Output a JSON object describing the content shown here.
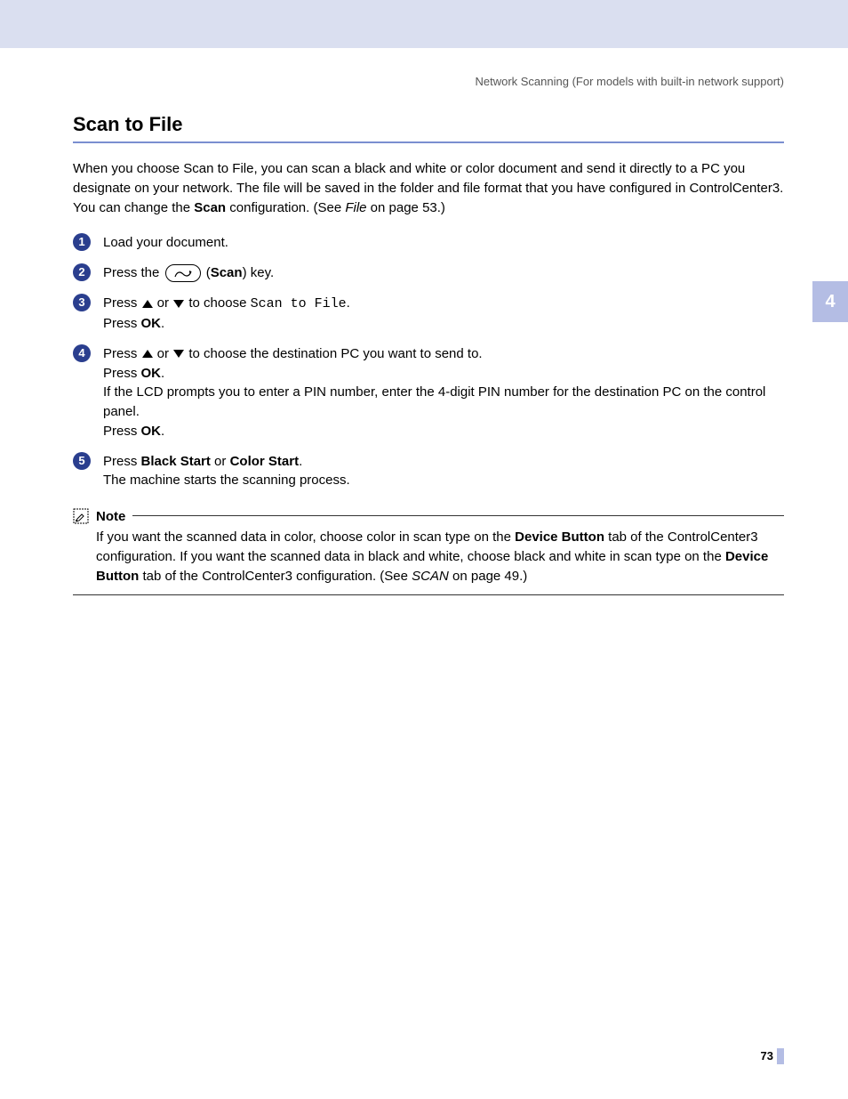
{
  "header": "Network Scanning (For models with built-in network support)",
  "side_tab": "4",
  "title": "Scan to File",
  "intro_1": "When you choose Scan to File, you can scan a black and white or color document and send it directly to a PC you designate on your network. The file will be saved in the folder and file format that you have configured in ControlCenter3. You can change the ",
  "intro_scan": "Scan",
  "intro_2": " configuration. (See ",
  "intro_file": "File",
  "intro_3": " on page 53.)",
  "steps": {
    "s1": "Load your document.",
    "s2_a": "Press the ",
    "s2_b": " (",
    "s2_scan": "Scan",
    "s2_c": ") key.",
    "s3_a": "Press ",
    "s3_or": " or ",
    "s3_b": " to choose ",
    "s3_mono": "Scan to File",
    "s3_c": ".",
    "s3_line2a": "Press ",
    "s3_ok": "OK",
    "s3_line2b": ".",
    "s4_a": "Press ",
    "s4_or": " or ",
    "s4_b": " to choose the destination PC you want to send to.",
    "s4_line2a": "Press ",
    "s4_ok": "OK",
    "s4_line2b": ".",
    "s4_line3": "If the LCD prompts you to enter a PIN number, enter the 4-digit PIN number for the destination PC on the control panel.",
    "s4_line4a": "Press ",
    "s4_ok2": "OK",
    "s4_line4b": ".",
    "s5_a": "Press ",
    "s5_bs": "Black Start",
    "s5_or": " or ",
    "s5_cs": "Color Start",
    "s5_b": ".",
    "s5_line2": "The machine starts the scanning process."
  },
  "note": {
    "title": "Note",
    "body_1": "If you want the scanned data in color, choose color in scan type on the ",
    "db1": "Device Button",
    "body_2": " tab of the ControlCenter3 configuration. If you want the scanned data in black and white, choose black and white in scan type on the ",
    "db2": "Device Button",
    "body_3": " tab of the ControlCenter3 configuration. (See ",
    "scan_ref": "SCAN",
    "body_4": " on page 49.)"
  },
  "page_number": "73"
}
